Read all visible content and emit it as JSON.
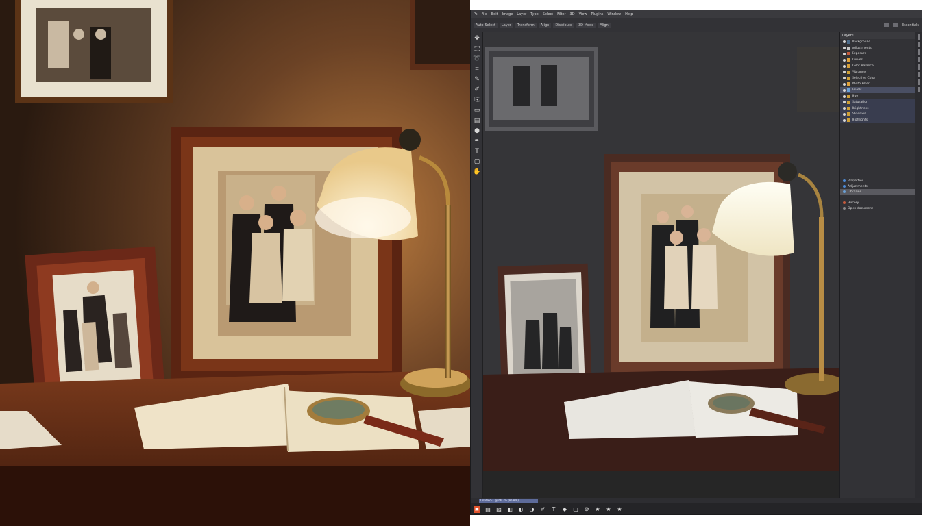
{
  "left_photo": {
    "description_visible": "",
    "accent_colors": {
      "wall": "#4a2f1a",
      "lamp": "#f6dfa8",
      "desk": "#5a2514"
    }
  },
  "editor": {
    "menu": [
      "Ps",
      "File",
      "Edit",
      "Image",
      "Layer",
      "Type",
      "Select",
      "Filter",
      "3D",
      "View",
      "Plugins",
      "Window",
      "Help"
    ],
    "options": [
      "Auto-Select",
      "Layer",
      "Transform",
      "Align",
      "Distribute",
      "3D Mode",
      "Align"
    ],
    "workspace_label": "Essentials",
    "tools": [
      "move-icon",
      "marquee-icon",
      "lasso-icon",
      "crop-icon",
      "eyedropper-icon",
      "brush-icon",
      "clone-icon",
      "eraser-icon",
      "gradient-icon",
      "dodge-icon",
      "pen-icon",
      "type-icon",
      "shape-icon",
      "hand-icon"
    ],
    "panel_title": "Layers",
    "layers": [
      {
        "label": "Background",
        "color": "#4c6b8a",
        "state": "normal"
      },
      {
        "label": "Adjustments",
        "color": "#c8c8c8",
        "state": "normal"
      },
      {
        "label": "Exposure",
        "color": "#c45a3c",
        "state": "normal"
      },
      {
        "label": "Curves",
        "color": "#e0a23a",
        "state": "normal"
      },
      {
        "label": "Color Balance",
        "color": "#d5a03a",
        "state": "normal"
      },
      {
        "label": "Vibrance",
        "color": "#cfa036",
        "state": "normal"
      },
      {
        "label": "Selective Color",
        "color": "#cfa036",
        "state": "normal"
      },
      {
        "label": "Photo Filter",
        "color": "#e0a23a",
        "state": "normal"
      },
      {
        "label": "Levels",
        "color": "#6aa0d6",
        "state": "selected"
      },
      {
        "label": "Hue",
        "color": "#cfa036",
        "state": "normal"
      },
      {
        "label": "Saturation",
        "color": "#cfa036",
        "state": "dim"
      },
      {
        "label": "Brightness",
        "color": "#cfa036",
        "state": "dim"
      },
      {
        "label": "Shadows",
        "color": "#cfa036",
        "state": "dim"
      },
      {
        "label": "Highlights",
        "color": "#cfa036",
        "state": "dim"
      }
    ],
    "sub_panel": [
      {
        "label": "Properties",
        "color": "#4c8ad6",
        "state": "normal"
      },
      {
        "label": "Adjustments",
        "color": "#4c8ad6",
        "state": "normal"
      },
      {
        "label": "Libraries",
        "color": "#6aa0d6",
        "state": "selected"
      }
    ],
    "history_panel": [
      {
        "label": "History",
        "color": "#c45a3c"
      },
      {
        "label": "Open document",
        "color": "#8a8a8a"
      }
    ],
    "document_tab": "Untitled-1 @ 66.7% (RGB/8)",
    "dock_icons": [
      "app-icon",
      "folder-icon",
      "image-icon",
      "layers-icon",
      "adjust-icon",
      "mask-icon",
      "brush-icon",
      "text-icon",
      "shape-icon",
      "frame-icon",
      "settings-icon",
      "star-icon",
      "star-icon",
      "star-icon"
    ]
  }
}
